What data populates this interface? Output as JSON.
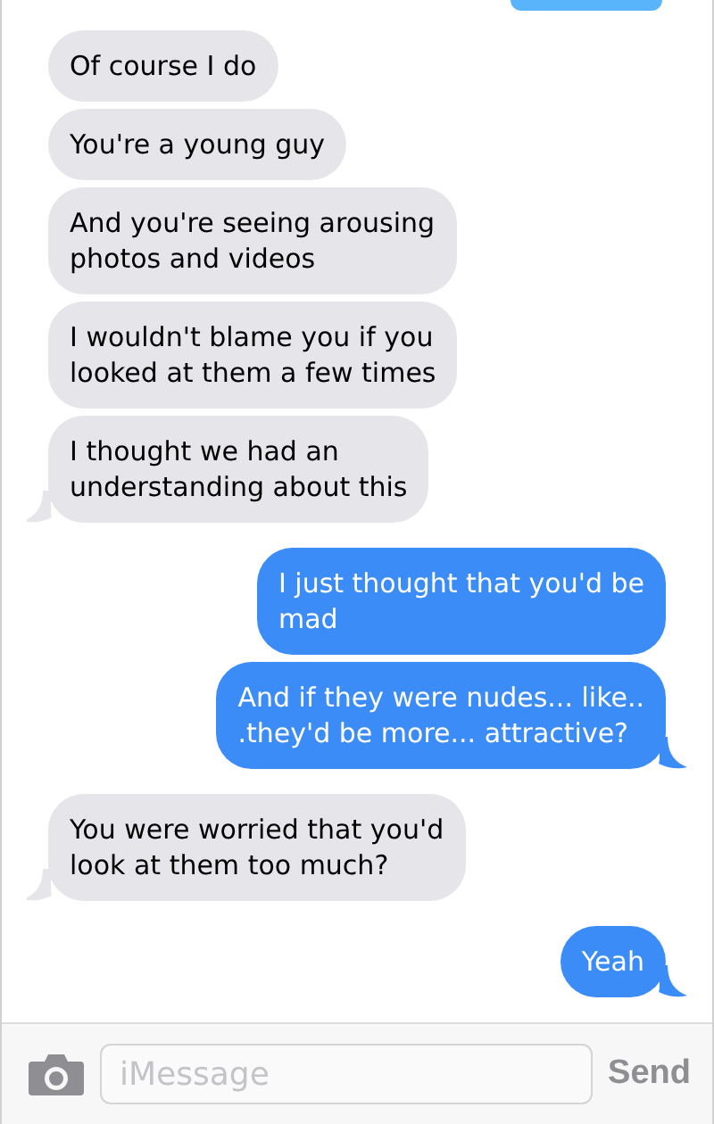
{
  "messages": [
    {
      "kind": "received",
      "text": "Of course I do",
      "tail": false
    },
    {
      "kind": "received",
      "text": "You're a young guy",
      "tail": false
    },
    {
      "kind": "received",
      "text": "And you're seeing arousing\nphotos and videos",
      "tail": false
    },
    {
      "kind": "received",
      "text": "I wouldn't blame you if you\nlooked at them a few times",
      "tail": false
    },
    {
      "kind": "received",
      "text": "I thought we had an\nunderstanding about this",
      "tail": true
    },
    {
      "kind": "sent",
      "text": "I just thought that you'd be\nmad",
      "tail": false
    },
    {
      "kind": "sent",
      "text": "And if they were nudes... like..\n.they'd be more... attractive?",
      "tail": true
    },
    {
      "kind": "received",
      "text": "You were worried that you'd\nlook at them too much?",
      "tail": true
    },
    {
      "kind": "sent",
      "text": "Yeah",
      "tail": true
    }
  ],
  "composer": {
    "placeholder": "iMessage",
    "send_label": "Send"
  }
}
